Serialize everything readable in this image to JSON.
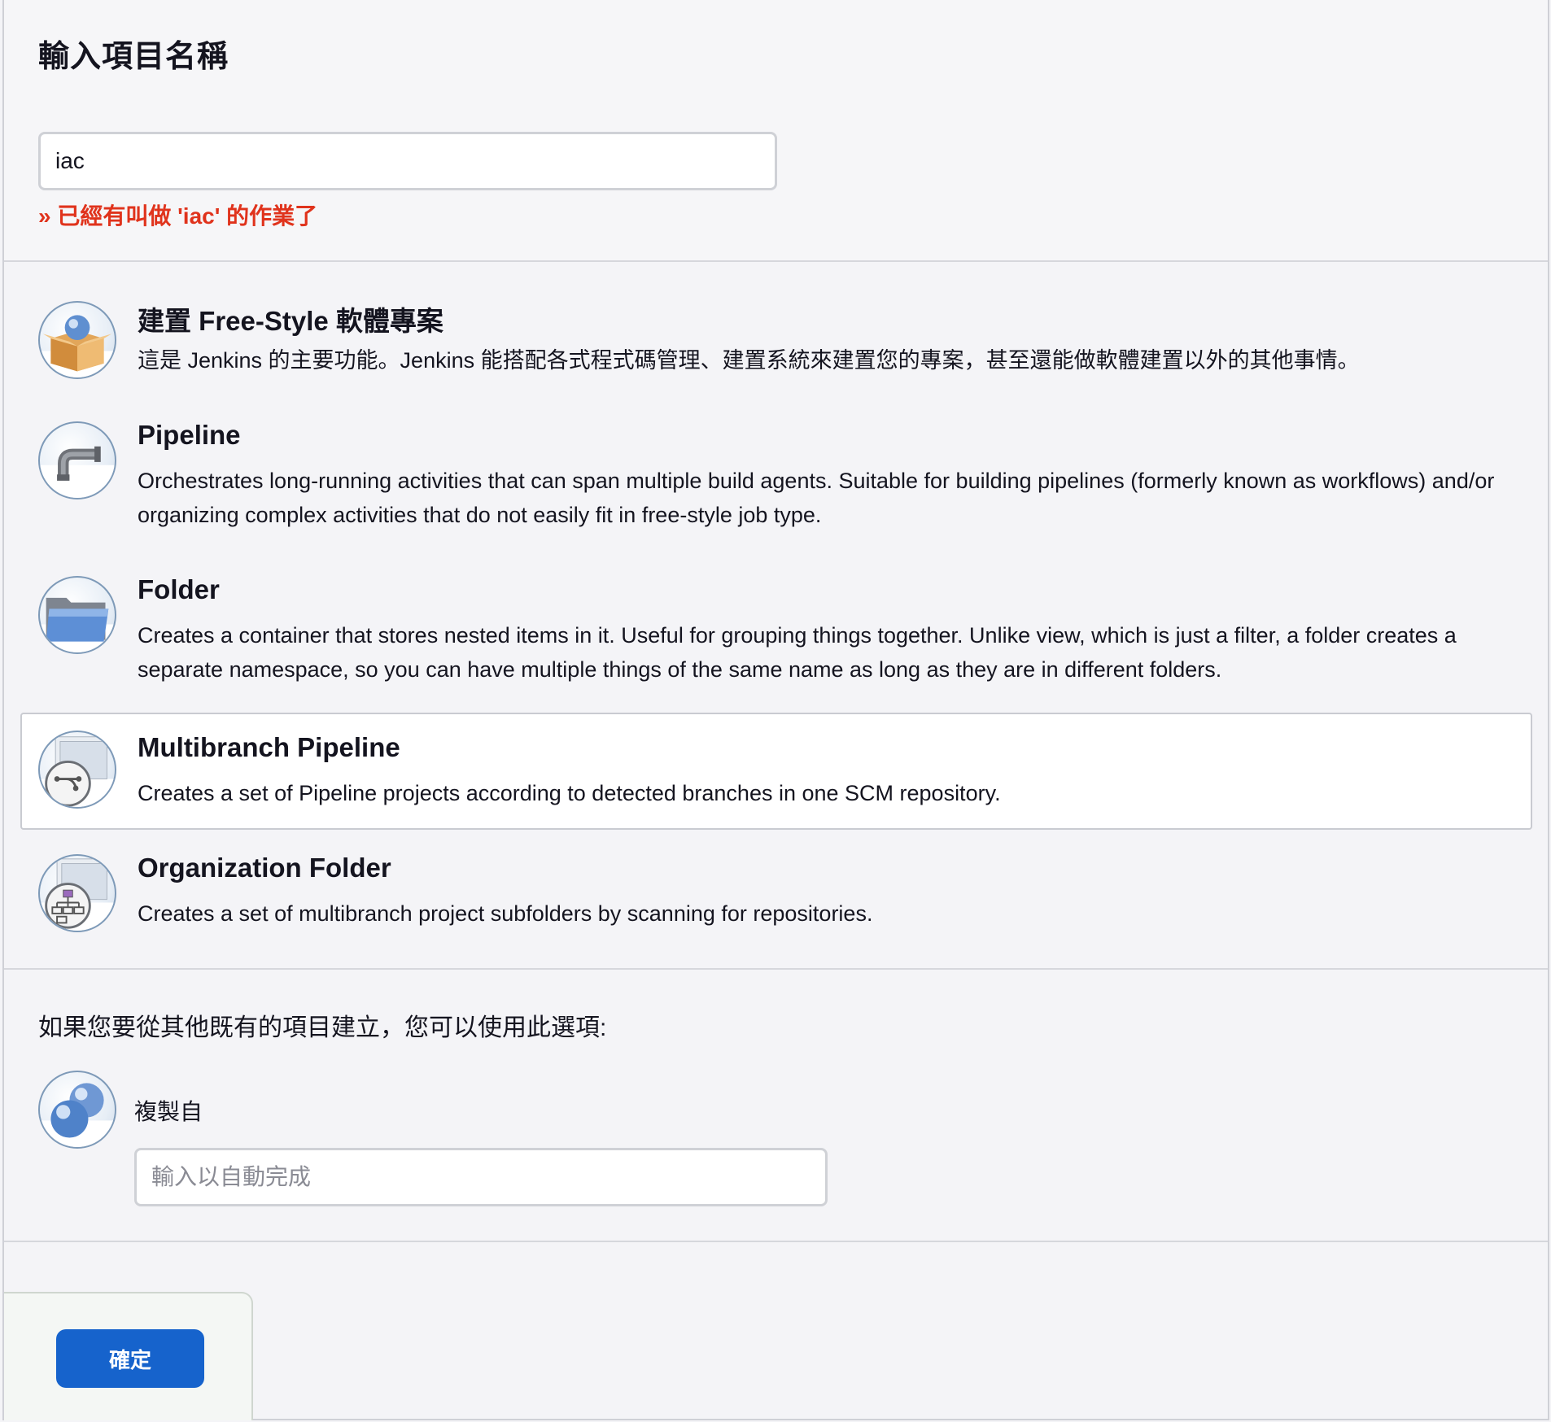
{
  "header": {
    "title": "輸入項目名稱"
  },
  "name_field": {
    "value": "iac",
    "error": "» 已經有叫做 'iac' 的作業了"
  },
  "item_types": [
    {
      "title": "建置 Free-Style 軟體專案",
      "description": "這是 Jenkins 的主要功能。Jenkins 能搭配各式程式碼管理、建置系統來建置您的專案，甚至還能做軟體建置以外的其他事情。",
      "icon": "freestyle-box-icon",
      "selected": false
    },
    {
      "title": "Pipeline",
      "description": "Orchestrates long-running activities that can span multiple build agents. Suitable for building pipelines (formerly known as workflows) and/or organizing complex activities that do not easily fit in free-style job type.",
      "icon": "pipe-icon",
      "selected": false
    },
    {
      "title": "Folder",
      "description": "Creates a container that stores nested items in it. Useful for grouping things together. Unlike view, which is just a filter, a folder creates a separate namespace, so you can have multiple things of the same name as long as they are in different folders.",
      "icon": "folder-icon",
      "selected": false
    },
    {
      "title": "Multibranch Pipeline",
      "description": "Creates a set of Pipeline projects according to detected branches in one SCM repository.",
      "icon": "multibranch-icon",
      "selected": true
    },
    {
      "title": "Organization Folder",
      "description": "Creates a set of multibranch project subfolders by scanning for repositories.",
      "icon": "organization-folder-icon",
      "selected": false
    }
  ],
  "copy_section": {
    "prompt": "如果您要從其他既有的項目建立，您可以使用此選項:",
    "label": "複製自",
    "placeholder": "輸入以自動完成",
    "icon": "copy-spheres-icon"
  },
  "footer": {
    "ok_label": "確定",
    "button_color": "#1663cc"
  },
  "colors": {
    "error": "#e0331c",
    "accent": "#1663cc"
  }
}
